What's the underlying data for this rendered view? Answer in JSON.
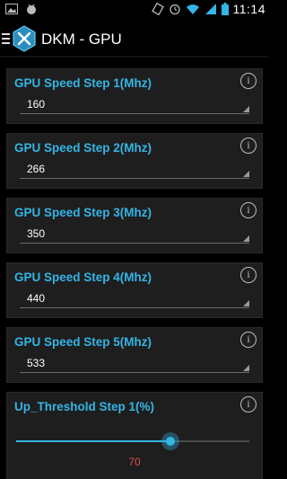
{
  "status_bar": {
    "time": "11:14"
  },
  "app": {
    "title": "DKM - GPU"
  },
  "cards": [
    {
      "title": "GPU Speed Step 1(Mhz)",
      "value": "160"
    },
    {
      "title": "GPU Speed Step 2(Mhz)",
      "value": "266"
    },
    {
      "title": "GPU Speed Step 3(Mhz)",
      "value": "350"
    },
    {
      "title": "GPU Speed Step 4(Mhz)",
      "value": "440"
    },
    {
      "title": "GPU Speed Step 5(Mhz)",
      "value": "533"
    }
  ],
  "threshold": {
    "title": "Up_Threshold Step 1(%)",
    "value": "70",
    "fraction": 0.66
  },
  "info_label": "i",
  "colors": {
    "accent": "#33b5e5",
    "value_red": "#e34a4a",
    "card_bg": "#1e1e1e"
  }
}
